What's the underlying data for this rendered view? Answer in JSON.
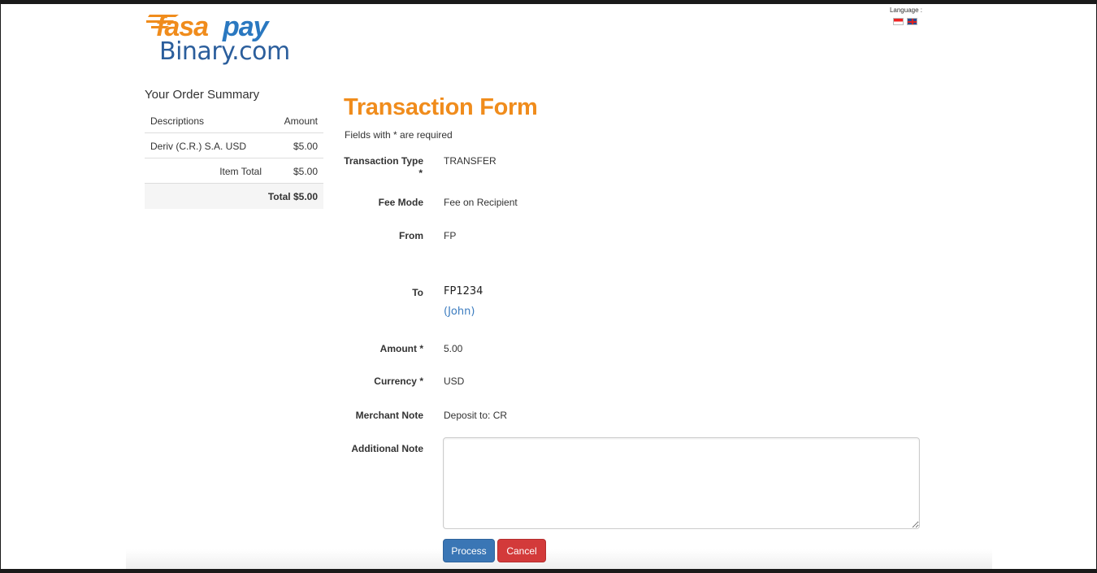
{
  "brand": {
    "logo_part1": "fasa",
    "logo_part2": "pay",
    "logo_sub": "Binary.com",
    "color_orange": "#f08c1c",
    "color_blue": "#2a78c0"
  },
  "language": {
    "label": "Language :",
    "flags": [
      "flag-indonesia-icon",
      "flag-uk-icon"
    ]
  },
  "order_summary": {
    "title": "Your Order Summary",
    "header": {
      "description": "Descriptions",
      "amount": "Amount"
    },
    "items": [
      {
        "description": "Deriv (C.R.) S.A. USD",
        "amount": "$5.00"
      }
    ],
    "item_total_label": "Item Total",
    "item_total_value": "$5.00",
    "total": "Total $5.00"
  },
  "form": {
    "title": "Transaction Form",
    "required_note": "Fields with * are required",
    "fields": {
      "transaction_type": {
        "label": "Transaction Type",
        "required_mark": "*",
        "value": "TRANSFER"
      },
      "fee_mode": {
        "label": "Fee Mode",
        "value": "Fee on Recipient"
      },
      "from": {
        "label": "From",
        "value": "FP"
      },
      "to": {
        "label": "To",
        "value": "FP1234",
        "name": "(John)"
      },
      "amount": {
        "label": "Amount *",
        "value": "5.00"
      },
      "currency": {
        "label": "Currency *",
        "value": "USD"
      },
      "merchant_note": {
        "label": "Merchant Note",
        "value": "Deposit to: CR"
      },
      "additional_note": {
        "label": "Additional Note",
        "value": ""
      }
    },
    "buttons": {
      "process": "Process",
      "cancel": "Cancel",
      "process_color": "#3a76b5",
      "cancel_color": "#d33a3a"
    }
  }
}
